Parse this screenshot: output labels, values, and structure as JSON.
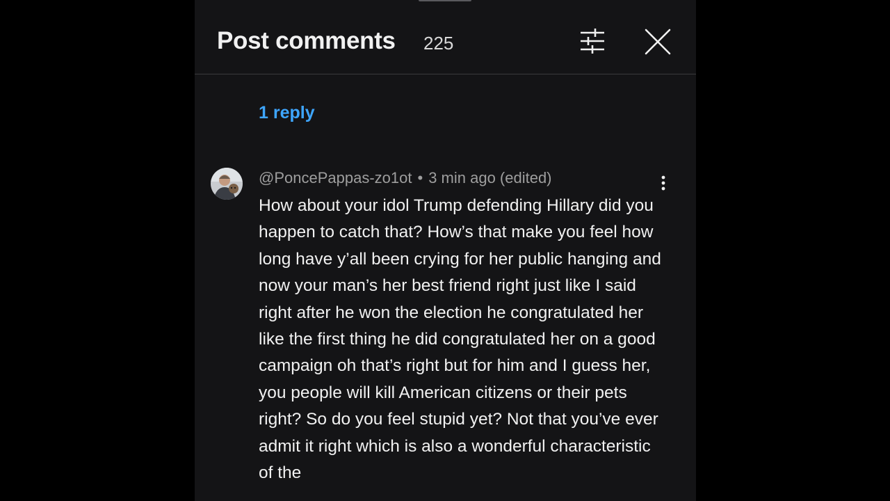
{
  "header": {
    "title": "Post comments",
    "count": "225",
    "filter_icon": "sliders-icon",
    "close_icon": "close-icon"
  },
  "replies": {
    "label": "1 reply"
  },
  "comment": {
    "author": "@PoncePappas-zo1ot",
    "separator": "•",
    "time": "3 min ago (edited)",
    "menu_icon": "more-vertical-icon",
    "text": "How about your idol Trump defending Hillary did you happen to catch that? How’s that make you feel how long have y’all been crying for her public hanging and now your man’s her best friend right just like I said right after he won the election he congratulated her like the first thing he did congratulated her on a good campaign oh that’s right but for him and I guess her, you people will kill American citizens or their pets right? So do you feel stupid yet? Not that you’ve ever admit it right which is also a wonderful characteristic of the"
  },
  "colors": {
    "background": "#000000",
    "panel": "#141416",
    "text": "#f1f1f1",
    "secondary_text": "#9e9e9e",
    "link": "#3ea6ff",
    "divider": "#3a3a3d"
  }
}
